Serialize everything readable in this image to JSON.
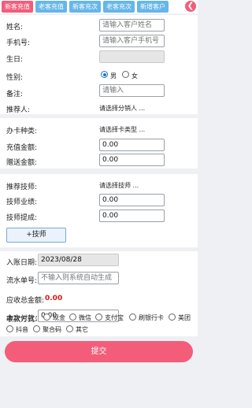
{
  "tabs": [
    "新客充值",
    "老客充值",
    "新客充次",
    "老客充次",
    "新增客户"
  ],
  "back_icon": "chevron-left-icon",
  "customer": {
    "name_label": "姓名:",
    "name_placeholder": "请输入客户姓名",
    "phone_label": "手机号:",
    "phone_placeholder": "请输入客户手机号",
    "birthday_label": "生日:",
    "birthday_value": "",
    "gender_label": "性别:",
    "gender_male": "男",
    "gender_female": "女",
    "gender_selected": "男",
    "note_label": "备注:",
    "note_placeholder": "请输入",
    "referrer_label": "推荐人:",
    "referrer_value": "请选择分销人 ..."
  },
  "card_section": {
    "type_label": "办卡种类:",
    "type_value": "请选择卡类型 ...",
    "recharge_label": "充值金额:",
    "recharge_value": "0.00",
    "gift_label": "赠送金额:",
    "gift_value": "0.00"
  },
  "tech_section": {
    "tech_label": "推荐技师:",
    "tech_value": "请选择技师 ...",
    "perf_label": "技师业绩:",
    "perf_value": "0.00",
    "commission_label": "技师提成:",
    "commission_value": "0.00",
    "add_tech_label": "+技师"
  },
  "payment": {
    "date_label": "入账日期:",
    "date_value": "2023/08/28",
    "serial_label": "流水单号:",
    "serial_placeholder": "不输入则系统自动生成",
    "due_label": "应收总金额:",
    "due_value": "0.00",
    "pay_label": "本次付款：",
    "pay_value": "0.00",
    "method_label": "收款方式:",
    "methods": [
      "现金",
      "微信",
      "支付宝",
      "刷银行卡",
      "美团",
      "抖音",
      "聚合码",
      "其它"
    ]
  },
  "submit_label": "提交"
}
